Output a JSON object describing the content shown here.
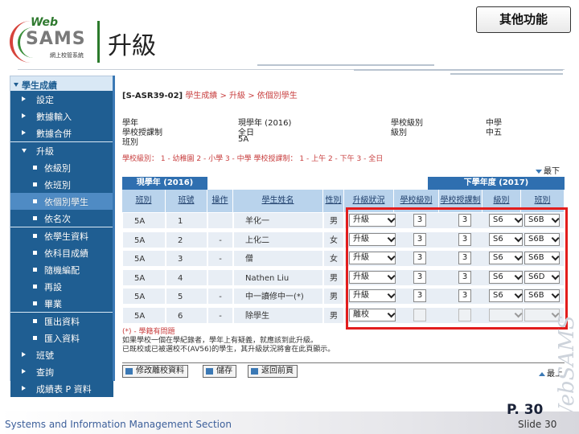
{
  "header": {
    "logo": {
      "web": "Web",
      "sams": "SAMS",
      "subtitle": "網上校管系統"
    },
    "title": "升級",
    "other_button": "其他功能"
  },
  "sidebar": {
    "top": "學生成績",
    "items": [
      {
        "label": "設定",
        "kind": "tri"
      },
      {
        "label": "數據輸入",
        "kind": "tri"
      },
      {
        "label": "數據合併",
        "kind": "tri"
      },
      {
        "label": "升級",
        "kind": "down"
      },
      {
        "label": "依級別",
        "kind": "dot"
      },
      {
        "label": "依班別",
        "kind": "dot"
      },
      {
        "label": "依個別學生",
        "kind": "dot",
        "selected": true
      },
      {
        "label": "依名次",
        "kind": "dot"
      },
      {
        "label": "依學生資料",
        "kind": "dot"
      },
      {
        "label": "依科目成績",
        "kind": "dot"
      },
      {
        "label": "隨機編配",
        "kind": "dot"
      },
      {
        "label": "再設",
        "kind": "dot"
      },
      {
        "label": "畢業",
        "kind": "dot"
      },
      {
        "label": "匯出資料",
        "kind": "dot"
      },
      {
        "label": "匯入資料",
        "kind": "dot"
      },
      {
        "label": "班號",
        "kind": "tri"
      },
      {
        "label": "查詢",
        "kind": "tri"
      },
      {
        "label": "成績表 P 資料",
        "kind": "tri"
      }
    ]
  },
  "breadcrumb": {
    "code": "[S-ASR39-02]",
    "path": "學生成績 > 升級 > 依個別學生"
  },
  "info": {
    "rows": [
      {
        "l1": "學年",
        "v1": "現學年 (2016)",
        "l2": "學校級別",
        "v2": "中學"
      },
      {
        "l1": "學校授課制",
        "v1": "全日",
        "l2": "級別",
        "v2": "中五"
      },
      {
        "l1": "班別",
        "v1": "5A",
        "l2": "",
        "v2": ""
      }
    ]
  },
  "legend_text": "學校級別： 1 - 幼稚園   2 - 小學   3 - 中學     學校授課制： 1 - 上午   2 - 下午   3 - 全日",
  "down_link": "最下",
  "up_link": "最上",
  "table": {
    "group_current": "現學年 (2016)",
    "group_next": "下學年度 (2017)",
    "headers": [
      "班別",
      "班號",
      "操作",
      "學生姓名",
      "性別",
      "升級狀況",
      "學校級別",
      "學校授課制",
      "級別",
      "班別"
    ],
    "rows": [
      {
        "cls": "5A",
        "no": "1",
        "op": "",
        "name": "羊化一",
        "sex": "男",
        "status": "升級",
        "lvl": "3",
        "sess": "3",
        "grade": "S6",
        "ncls": "S6B",
        "disabled": false
      },
      {
        "cls": "5A",
        "no": "2",
        "op": "-",
        "name": "上化二",
        "sex": "女",
        "status": "升級",
        "lvl": "3",
        "sess": "3",
        "grade": "S6",
        "ncls": "S6B",
        "disabled": false
      },
      {
        "cls": "5A",
        "no": "3",
        "op": "-",
        "name": "僧",
        "sex": "女",
        "status": "升級",
        "lvl": "3",
        "sess": "3",
        "grade": "S6",
        "ncls": "S6B",
        "disabled": false
      },
      {
        "cls": "5A",
        "no": "4",
        "op": "",
        "name": "Nathen Liu",
        "sex": "男",
        "status": "升級",
        "lvl": "3",
        "sess": "3",
        "grade": "S6",
        "ncls": "S6D",
        "disabled": false
      },
      {
        "cls": "5A",
        "no": "5",
        "op": "-",
        "name": "中一讀修中一(*)",
        "sex": "男",
        "status": "升級",
        "lvl": "3",
        "sess": "3",
        "grade": "S6",
        "ncls": "S6B",
        "disabled": false
      },
      {
        "cls": "5A",
        "no": "6",
        "op": "-",
        "name": "除學生",
        "sex": "男",
        "status": "離校",
        "lvl": "",
        "sess": "",
        "grade": "",
        "ncls": "",
        "disabled": true
      }
    ]
  },
  "notes": {
    "n1": "(*) - 學籍有問題",
    "n2": "如果學校一個在學紀錄者，學年上有疑義，就應該到此升級。",
    "n3": "已既校或已被選校不(AV56)的學生，其升級狀況將會在此頁顯示。"
  },
  "buttons": {
    "edit_school": "修改離校資料",
    "save": "儲存",
    "back": "返回前頁"
  },
  "footer": {
    "org": "Systems and Information Management Section",
    "page": "P. 30",
    "slide": "Slide 30"
  },
  "watermark": "WebSAMS"
}
